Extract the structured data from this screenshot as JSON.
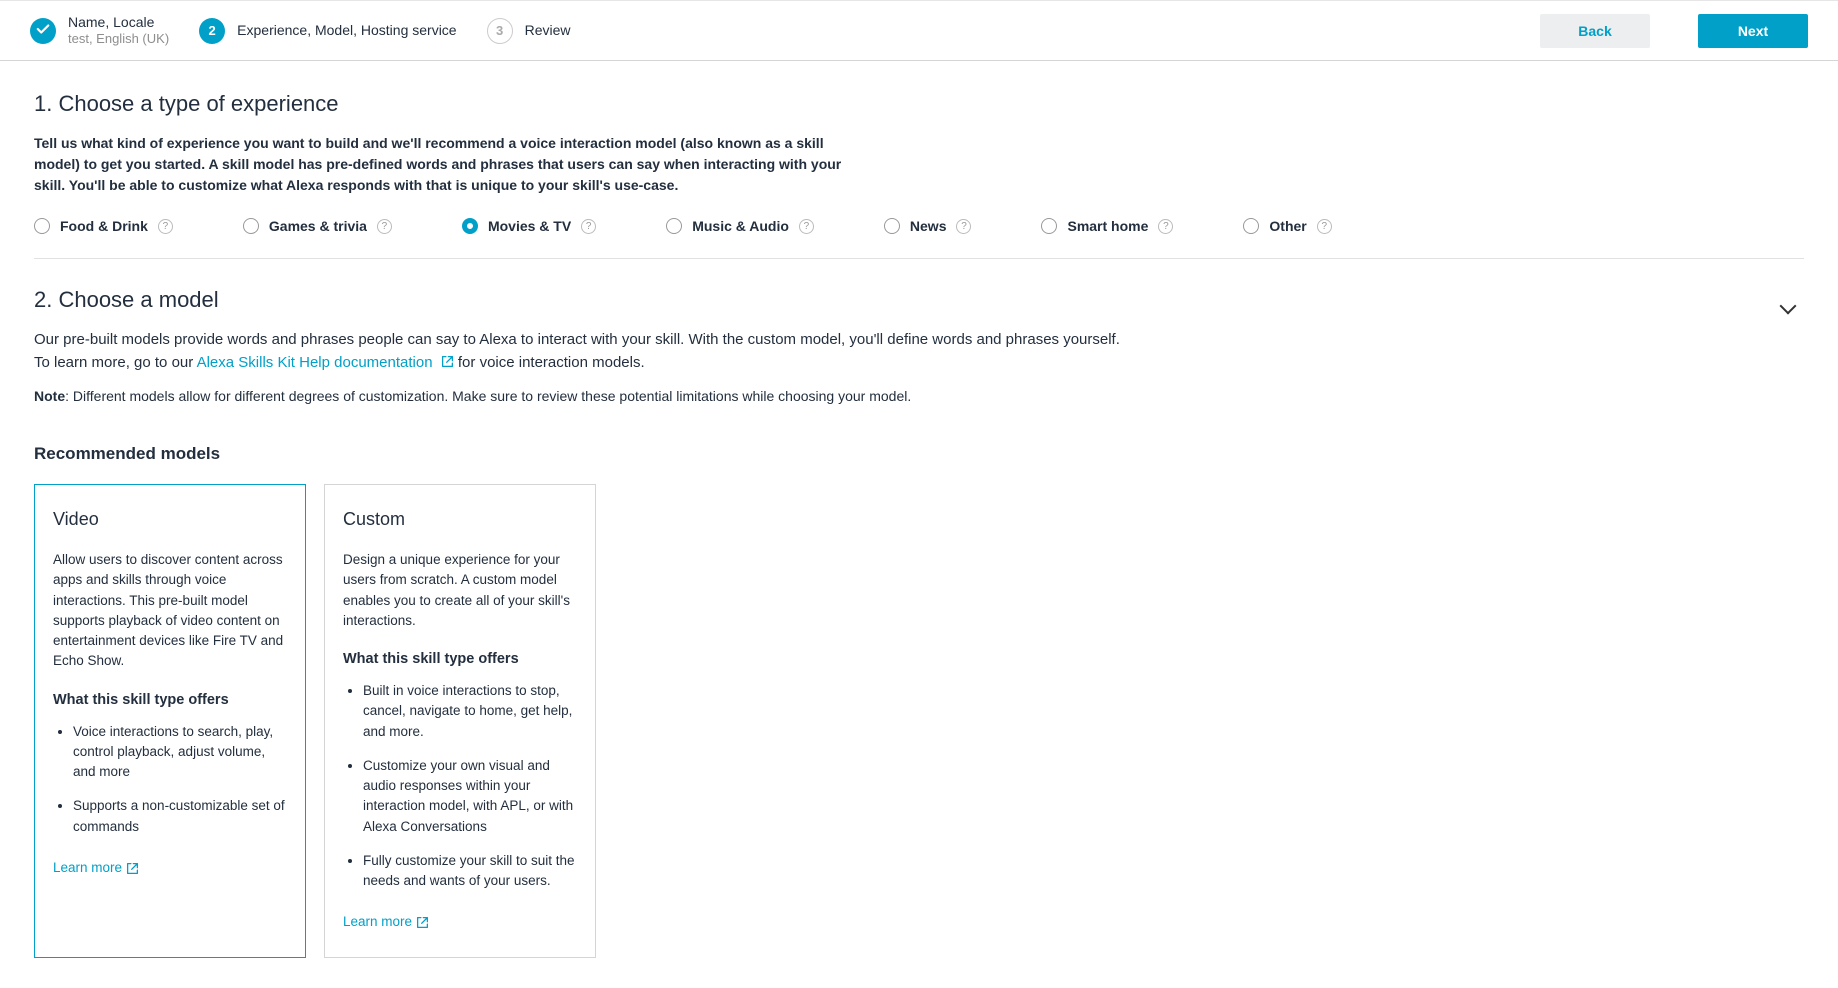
{
  "header": {
    "steps": [
      {
        "title": "Name, Locale",
        "subtitle": "test, English (UK)",
        "state": "completed"
      },
      {
        "title": "Experience, Model, Hosting service",
        "state": "active",
        "number": "2"
      },
      {
        "title": "Review",
        "state": "pending",
        "number": "3"
      }
    ],
    "back": "Back",
    "next": "Next"
  },
  "section1": {
    "title": "1. Choose a type of experience",
    "desc": "Tell us what kind of experience you want to build and we'll recommend a voice interaction model (also known as a skill model) to get you started. A skill model has pre-defined words and phrases that users can say when interacting with your skill. You'll be able to customize what Alexa responds with that is unique to your skill's use-case.",
    "options": [
      {
        "label": "Food & Drink",
        "selected": false
      },
      {
        "label": "Games & trivia",
        "selected": false
      },
      {
        "label": "Movies & TV",
        "selected": true
      },
      {
        "label": "Music & Audio",
        "selected": false
      },
      {
        "label": "News",
        "selected": false
      },
      {
        "label": "Smart home",
        "selected": false
      },
      {
        "label": "Other",
        "selected": false
      }
    ]
  },
  "section2": {
    "title": "2. Choose a model",
    "desc_pre": "Our pre-built models provide words and phrases people can say to Alexa to interact with your skill. With the custom model, you'll define words and phrases yourself. To learn more, go to our ",
    "link": "Alexa Skills Kit Help documentation",
    "desc_post": " for voice interaction models.",
    "note_label": "Note",
    "note_text": ": Different models allow for different degrees of customization. Make sure to review these potential limitations while choosing your model.",
    "recommended": "Recommended models",
    "offers_label": "What this skill type offers",
    "learn_more": "Learn more",
    "cards": [
      {
        "title": "Video",
        "desc": "Allow users to discover content across apps and skills through voice interactions. This pre-built model supports playback of video content on entertainment devices like Fire TV and Echo Show.",
        "offers": [
          "Voice interactions to search, play, control playback, adjust volume, and more",
          "Supports a non-customizable set of commands"
        ],
        "selected": true
      },
      {
        "title": "Custom",
        "desc": "Design a unique experience for your users from scratch. A custom model enables you to create all of your skill's interactions.",
        "offers": [
          "Built in voice interactions to stop, cancel, navigate to home, get help, and more.",
          "Customize your own visual and audio responses within your interaction model, with APL, or with Alexa Conversations",
          "Fully customize your skill to suit the needs and wants of your users."
        ],
        "selected": false
      }
    ]
  }
}
